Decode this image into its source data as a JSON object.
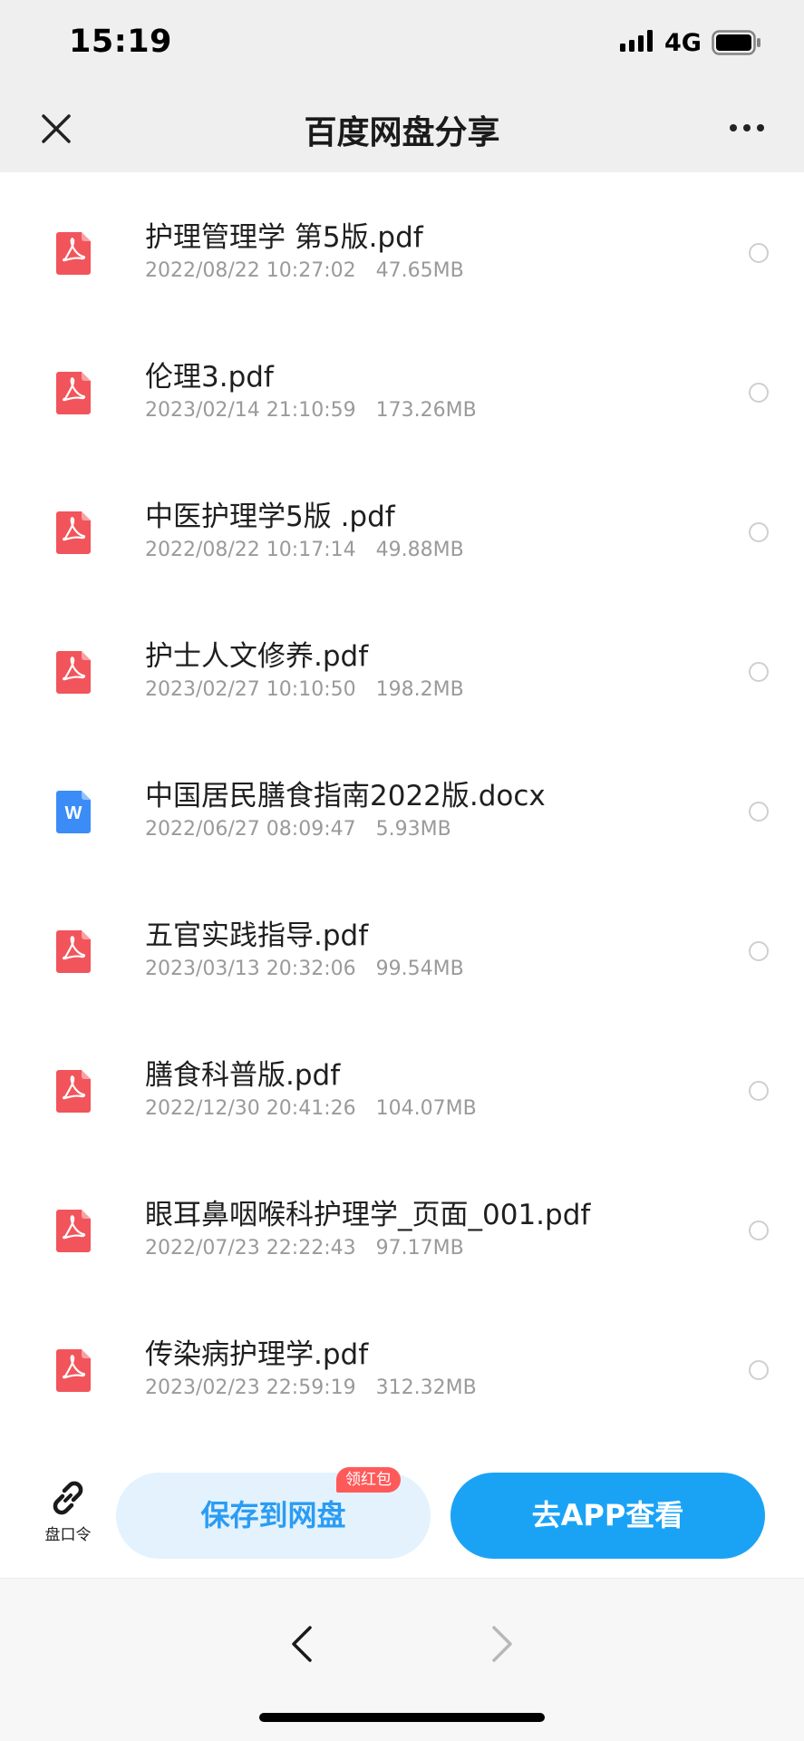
{
  "status_bar": {
    "time": "15:19",
    "network": "4G"
  },
  "nav": {
    "title": "百度网盘分享"
  },
  "files": [
    {
      "name": "护理管理学 第5版.pdf",
      "date": "2022/08/22 10:27:02",
      "size": "47.65MB",
      "type": "pdf"
    },
    {
      "name": "伦理3.pdf",
      "date": "2023/02/14 21:10:59",
      "size": "173.26MB",
      "type": "pdf"
    },
    {
      "name": "中医护理学5版 .pdf",
      "date": "2022/08/22 10:17:14",
      "size": "49.88MB",
      "type": "pdf"
    },
    {
      "name": "护士人文修养.pdf",
      "date": "2023/02/27 10:10:50",
      "size": "198.2MB",
      "type": "pdf"
    },
    {
      "name": "中国居民膳食指南2022版.docx",
      "date": "2022/06/27 08:09:47",
      "size": "5.93MB",
      "type": "docx"
    },
    {
      "name": "五官实践指导.pdf",
      "date": "2023/03/13 20:32:06",
      "size": "99.54MB",
      "type": "pdf"
    },
    {
      "name": "膳食科普版.pdf",
      "date": "2022/12/30 20:41:26",
      "size": "104.07MB",
      "type": "pdf"
    },
    {
      "name": "眼耳鼻咽喉科护理学_页面_001.pdf",
      "date": "2022/07/23 22:22:43",
      "size": "97.17MB",
      "type": "pdf"
    },
    {
      "name": "传染病护理学.pdf",
      "date": "2023/02/23 22:59:19",
      "size": "312.32MB",
      "type": "pdf"
    }
  ],
  "actions": {
    "pankouling_label": "盘口令",
    "save_label": "保存到网盘",
    "save_badge": "领红包",
    "open_app_label": "去APP查看"
  },
  "colors": {
    "pdf_icon": "#f2545b",
    "doc_icon": "#3b8cf7",
    "accent": "#1aa3f5",
    "save_bg": "#e3f2fd"
  }
}
